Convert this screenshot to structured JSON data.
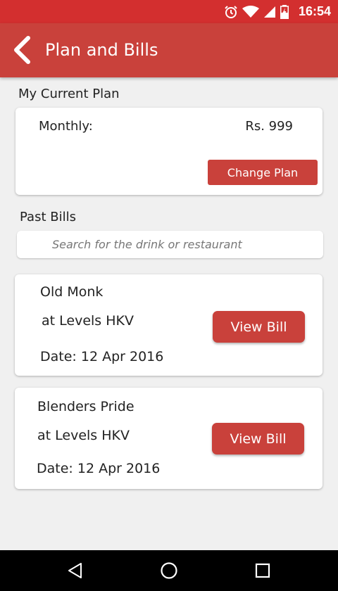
{
  "status_bar": {
    "time": "16:54",
    "icons": [
      "alarm-icon",
      "wifi-icon",
      "signal-icon",
      "battery-charging-icon"
    ]
  },
  "app_bar": {
    "title": "Plan and Bills",
    "back_icon": "chevron-left-icon"
  },
  "current_plan": {
    "section_title": "My Current Plan",
    "label": "Monthly:",
    "price": "Rs. 999",
    "button_label": "Change Plan"
  },
  "past_bills": {
    "section_title": "Past Bills",
    "search_placeholder": "Search for the drink or restaurant",
    "search_value": "",
    "bills": [
      {
        "drink": "Old Monk",
        "venue": "at Levels HKV",
        "date": "Date: 12 Apr 2016",
        "button_label": "View Bill"
      },
      {
        "drink": "Blenders Pride",
        "venue": "at Levels HKV",
        "date": "Date: 12 Apr 2016",
        "button_label": "View Bill"
      }
    ]
  },
  "nav_bar": {
    "icons": [
      "nav-back-icon",
      "nav-home-icon",
      "nav-recents-icon"
    ]
  },
  "colors": {
    "status_bar": "#d32f2f",
    "app_bar": "#c9413b",
    "accent": "#c9413b",
    "background": "#f0f0f0",
    "card": "#ffffff",
    "nav_bar": "#000000"
  }
}
